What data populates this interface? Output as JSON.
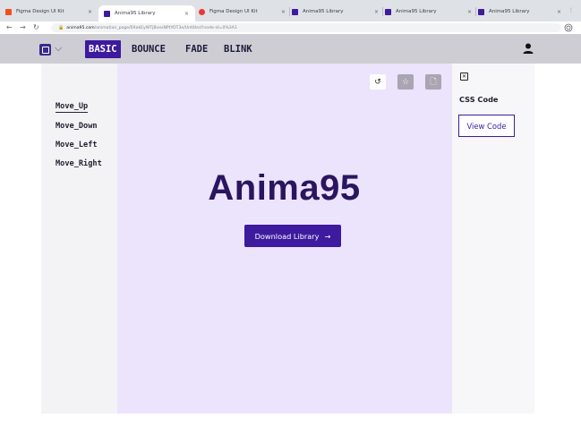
{
  "browser": {
    "tabs": [
      {
        "title": "Figma Design UI Kit",
        "favicon": "figma-icon",
        "active": false
      },
      {
        "title": "Anima95 Library",
        "favicon": "anima-icon",
        "active": true
      },
      {
        "title": "Figma Design UI Kit",
        "favicon": "figma-red-icon",
        "active": false
      },
      {
        "title": "Anima95 Library",
        "favicon": "anima-icon",
        "active": false
      },
      {
        "title": "Anima95 Library",
        "favicon": "anima-icon",
        "active": false
      },
      {
        "title": "Anima95 Library",
        "favicon": "anima-icon",
        "active": false
      }
    ],
    "close_glyph": "×",
    "url_domain": "anima95.com",
    "url_path": "/animation_page/0XakEyWTjBvosNPtYOT3o/Untitled?node-id=0%3A1"
  },
  "nav": {
    "menu": [
      "BASIC",
      "BOUNCE",
      "FADE",
      "BLINK"
    ],
    "active_menu": "BASIC",
    "chevron": "⌵"
  },
  "sidebar": {
    "items": [
      "Move_Up",
      "Move_Down",
      "Move_Left",
      "Move_Right"
    ],
    "active_item": "Move_Up"
  },
  "canvas": {
    "title": "Anima95",
    "download_label": "Download Library",
    "download_arrow": "→",
    "tools": {
      "undo": "↺",
      "star": "☆",
      "file": "🗋"
    }
  },
  "right_panel": {
    "close_glyph": "✕",
    "css_label": "CSS Code",
    "view_code_label": "View Code"
  },
  "colors": {
    "brand": "#3d1a9e",
    "canvas_bg": "#ece3fc",
    "title": "#2a1560"
  }
}
